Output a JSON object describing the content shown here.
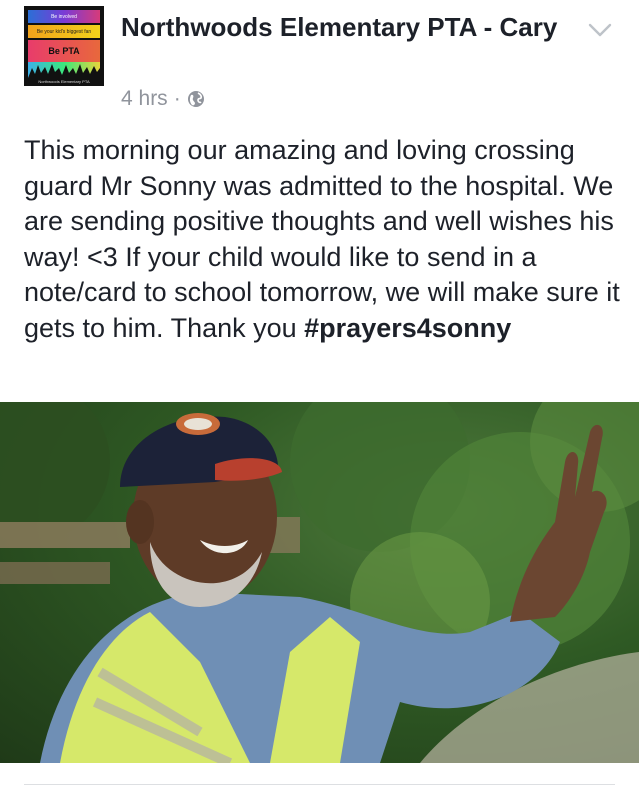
{
  "post": {
    "page_name": "Northwoods Elementary PTA - Cary",
    "timestamp": "4 hrs",
    "separator": "·",
    "audience_icon": "globe-icon",
    "options_icon": "chevron-down-icon",
    "text": "This morning our amazing and loving crossing guard Mr Sonny was admitted to the hospital. We are sending positive thoughts and well wishes his way! <3 If your child would like to send in a note/card to school tomorrow, we will make sure it gets to him. Thank you ",
    "hashtag": "#prayers4sonny"
  },
  "avatar": {
    "line1": "Be involved",
    "line2": "Be your kid's biggest fan",
    "line3": "Be PTA",
    "footer": "Northwoods Elementary PTA"
  },
  "colors": {
    "text": "#1d2129",
    "meta": "#90949c",
    "divider": "#dddfe2"
  }
}
